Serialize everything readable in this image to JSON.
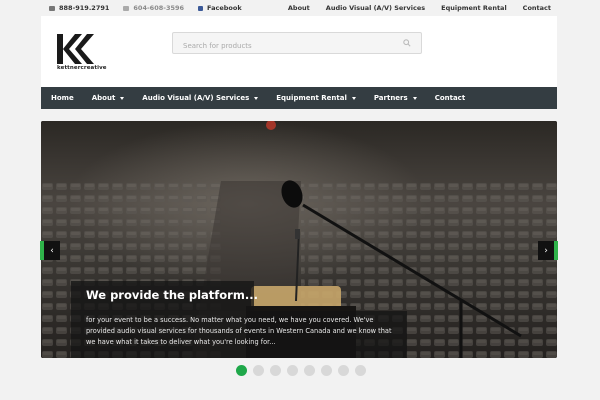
{
  "topbar": {
    "phone": "888-919.2791",
    "fax": "604-608-3596",
    "facebook": "Facebook",
    "links": [
      "About",
      "Audio Visual (A/V) Services",
      "Equipment Rental",
      "Contact"
    ]
  },
  "header": {
    "logo_text": "kettnercreative",
    "search_placeholder": "Search for products"
  },
  "nav": {
    "items": [
      {
        "label": "Home"
      },
      {
        "label": "About"
      },
      {
        "label": "Audio Visual (A/V) Services"
      },
      {
        "label": "Equipment Rental"
      },
      {
        "label": "Partners"
      },
      {
        "label": "Contact"
      }
    ]
  },
  "slider": {
    "title": "We provide the platform...",
    "body": "for your event to be a success. No matter what you need, we have you covered. We've provided audio visual services for thousands of events in Western Canada and we know that we have what it takes to deliver what you're looking for...",
    "prev": "‹",
    "next": "›",
    "slide_count": 8,
    "active_slide": 1
  },
  "colors": {
    "accent": "#1fa84a",
    "nav_bg": "#343d42"
  }
}
